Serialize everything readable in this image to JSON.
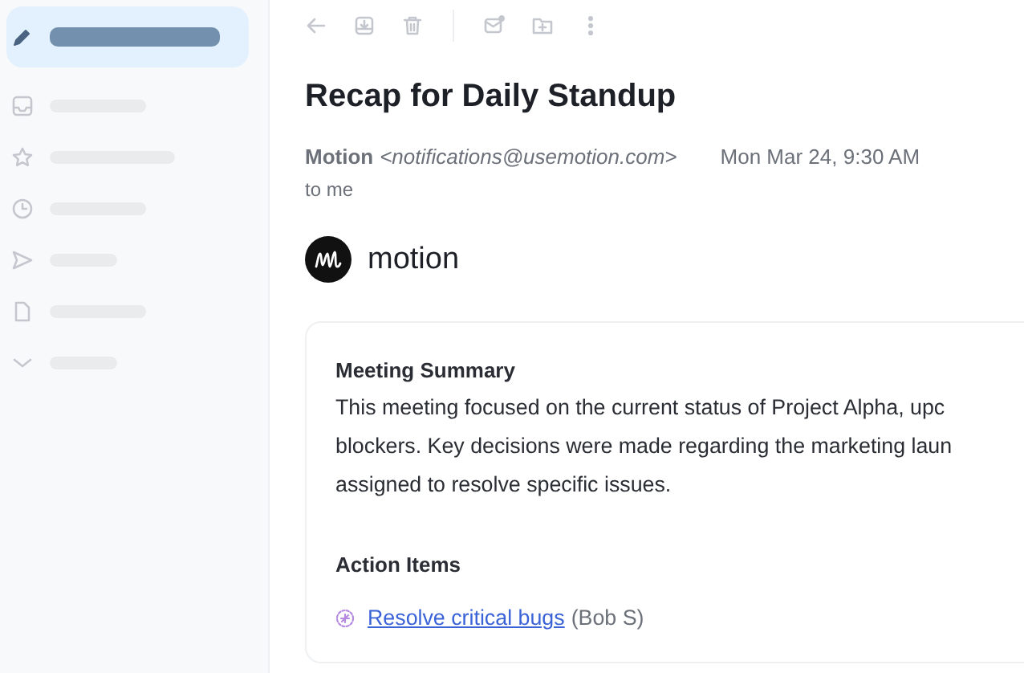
{
  "sidebar": {
    "items": [
      {
        "kind": "compose",
        "selected": true
      },
      {
        "kind": "inbox",
        "selected": false
      },
      {
        "kind": "starred",
        "selected": false
      },
      {
        "kind": "snoozed",
        "selected": false
      },
      {
        "kind": "sent",
        "selected": false
      },
      {
        "kind": "drafts",
        "selected": false
      },
      {
        "kind": "more",
        "selected": false
      }
    ]
  },
  "email": {
    "subject": "Recap for Daily Standup",
    "sender_name": "Motion",
    "sender_email": "<notifications@usemotion.com>",
    "date": "Mon Mar 24, 9:30 AM",
    "recipient": "to me",
    "brand": "motion",
    "summary_heading": "Meeting Summary",
    "summary_lines": [
      "This meeting focused on the current status of Project Alpha, upc",
      "blockers. Key decisions were made regarding the marketing laun",
      "assigned to resolve specific issues."
    ],
    "action_heading": "Action Items",
    "action_items": [
      {
        "task": "Resolve critical bugs",
        "owner": "(Bob S)"
      }
    ]
  }
}
